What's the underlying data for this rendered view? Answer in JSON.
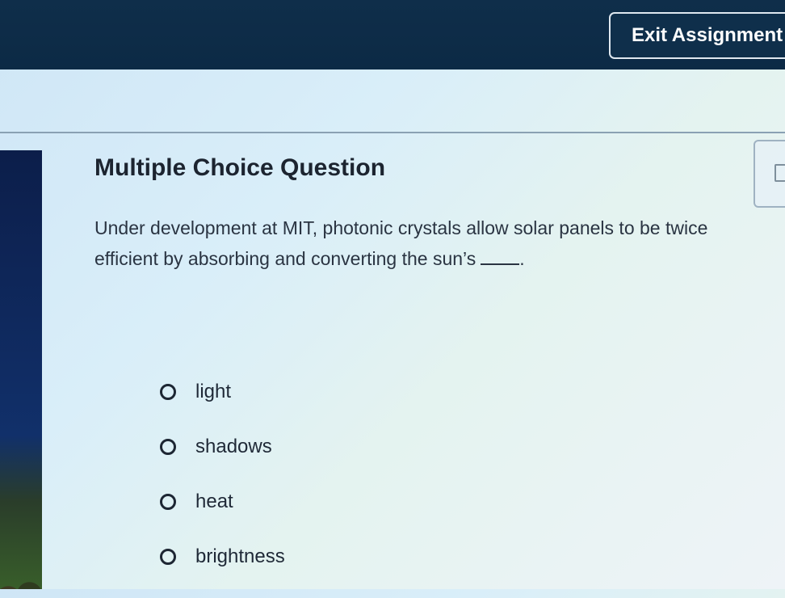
{
  "header": {
    "exit_label": "Exit Assignment"
  },
  "question": {
    "title": "Multiple Choice Question",
    "line1": "Under development at MIT, photonic crystals allow solar panels to be twice",
    "line2": "efficient by absorbing and converting the sun’s",
    "line2_end": "."
  },
  "options": [
    {
      "label": "light"
    },
    {
      "label": "shadows"
    },
    {
      "label": "heat"
    },
    {
      "label": "brightness"
    }
  ],
  "icons": {
    "radio": "radio-circle-icon",
    "side_tool": "square-bracket-icon"
  }
}
